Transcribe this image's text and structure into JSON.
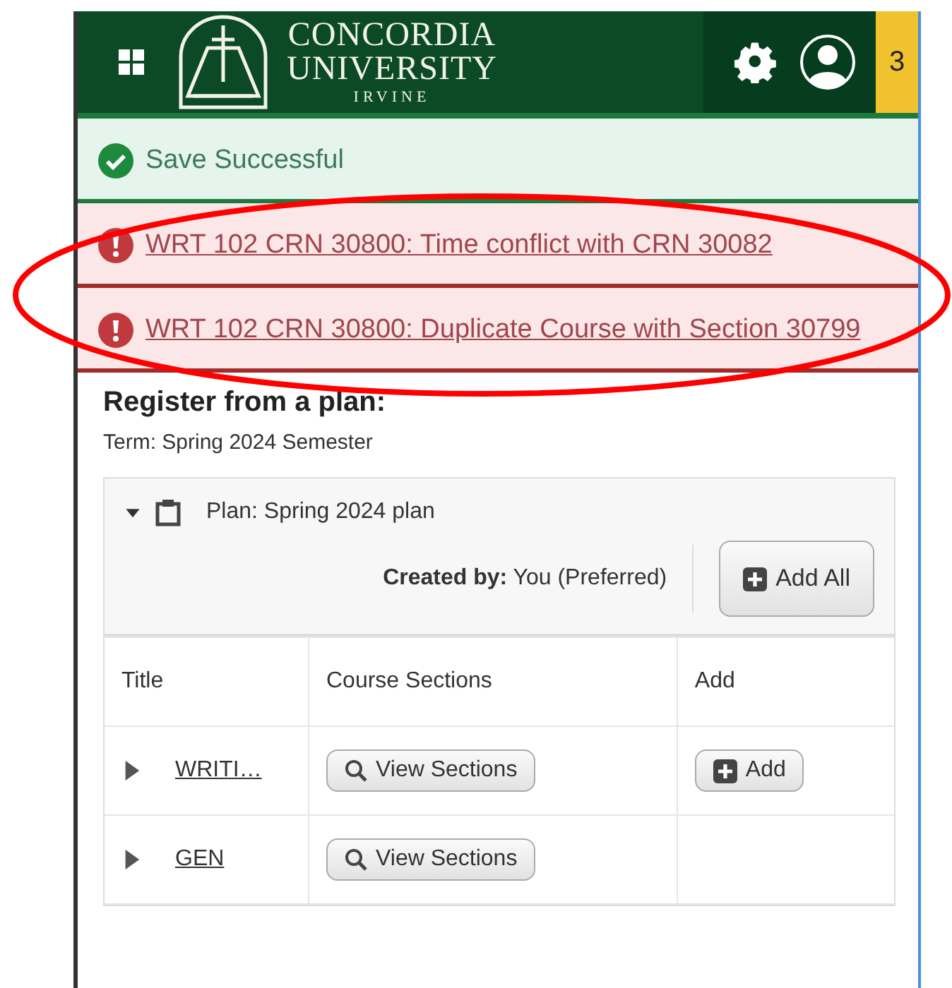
{
  "header": {
    "logo_line1": "CONCORDIA",
    "logo_line2": "UNIVERSITY",
    "logo_line3": "IRVINE",
    "badge": "3"
  },
  "alerts": [
    {
      "kind": "success",
      "text": "Save Successful"
    },
    {
      "kind": "error",
      "text": "WRT 102 CRN 30800: Time conflict with CRN 30082"
    },
    {
      "kind": "error",
      "text": "WRT 102 CRN 30800: Duplicate Course with Section 30799"
    }
  ],
  "heading": "Register from a plan:",
  "term": "Term: Spring 2024 Semester",
  "plan": {
    "title": "Plan: Spring 2024 plan",
    "expanded": true,
    "created_by": "**Created by:** You (Preferred)",
    "add_all": "Add All",
    "columns": [
      "Title",
      "Course Sections",
      "Add"
    ],
    "rows": [
      {
        "title": "WRITI…",
        "expanded": false,
        "view": "View Sections",
        "add": "Add"
      },
      {
        "title": "GEN",
        "expanded": false,
        "view": "View Sections"
      }
    ]
  }
}
